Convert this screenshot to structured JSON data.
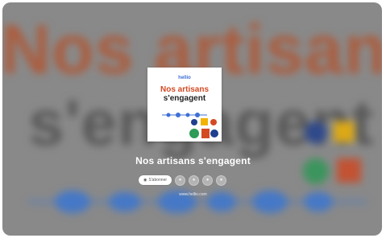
{
  "background": {
    "headline_line1": "Nos artisans",
    "headline_line2": "s'engagent"
  },
  "cover": {
    "brand": "hellio",
    "title_line1": "Nos artisans",
    "title_line2": "s'engagent"
  },
  "player": {
    "title": "Nos artisans s'engagent",
    "subscribe_label": "S'abonner",
    "share_buttons": [
      "share-icon-1",
      "share-icon-2",
      "share-icon-3",
      "share-icon-4"
    ],
    "url": "www.hellio.com"
  },
  "colors": {
    "accent_orange": "#d34a23",
    "brand_blue": "#3d6fd6",
    "overlay_gray": "#8d8d8d"
  }
}
